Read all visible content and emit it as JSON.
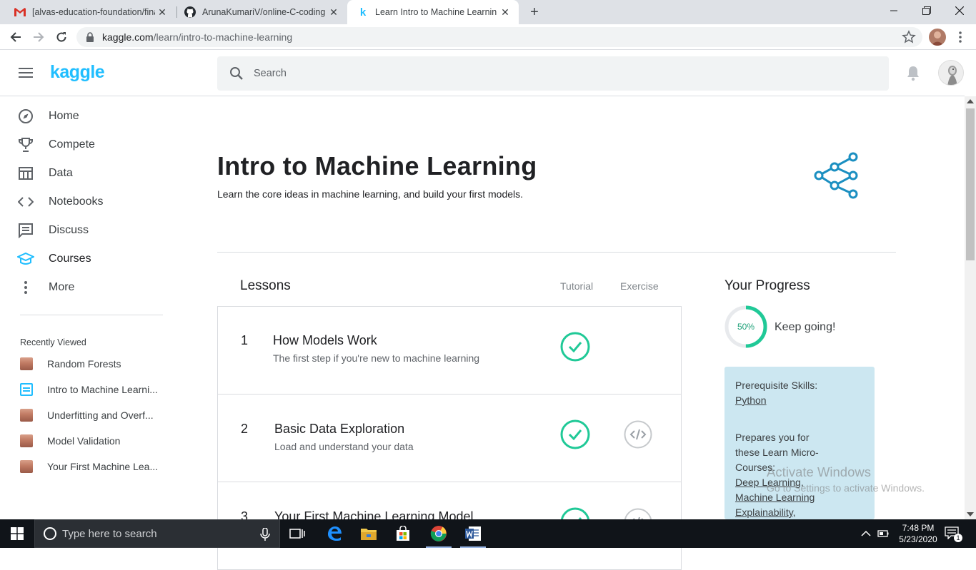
{
  "browser": {
    "tabs": [
      {
        "title": "[alvas-education-foundation/fina",
        "icon": "gmail-icon"
      },
      {
        "title": "ArunaKumariV/online-C-coding",
        "icon": "github-icon"
      },
      {
        "title": "Learn Intro to Machine Learning",
        "icon": "kaggle-icon"
      }
    ],
    "url_host": "kaggle.com",
    "url_path": "/learn/intro-to-machine-learning"
  },
  "header": {
    "logo": "kaggle",
    "search_placeholder": "Search"
  },
  "sidebar": {
    "items": [
      {
        "label": "Home",
        "icon": "compass-icon"
      },
      {
        "label": "Compete",
        "icon": "trophy-icon"
      },
      {
        "label": "Data",
        "icon": "table-icon"
      },
      {
        "label": "Notebooks",
        "icon": "code-icon"
      },
      {
        "label": "Discuss",
        "icon": "comment-icon"
      },
      {
        "label": "Courses",
        "icon": "graduation-cap-icon",
        "active": true
      },
      {
        "label": "More",
        "icon": "more-vertical-icon"
      }
    ],
    "recent_heading": "Recently Viewed",
    "recent": [
      "Random Forests",
      "Intro to Machine Learni...",
      "Underfitting and Overf...",
      "Model Validation",
      "Your First Machine Lea..."
    ]
  },
  "course": {
    "title": "Intro to Machine Learning",
    "subtitle": "Learn the core ideas in machine learning, and build your first models."
  },
  "lessons": {
    "heading": "Lessons",
    "col_tutorial": "Tutorial",
    "col_exercise": "Exercise",
    "items": [
      {
        "num": "1",
        "title": "How Models Work",
        "desc": "The first step if you're new to machine learning",
        "tutorial_done": true,
        "has_exercise": false
      },
      {
        "num": "2",
        "title": "Basic Data Exploration",
        "desc": "Load and understand your data",
        "tutorial_done": true,
        "has_exercise": true
      },
      {
        "num": "3",
        "title": "Your First Machine Learning Model",
        "desc": "",
        "tutorial_done": true,
        "has_exercise": true
      }
    ]
  },
  "progress": {
    "heading": "Your Progress",
    "percent": 50,
    "percent_label": "50%",
    "message": "Keep going!",
    "prereq_label": "Prerequisite Skills:",
    "prereq_link": "Python",
    "prepares_label": "Prepares you for these Learn Micro-Courses:",
    "prepares_links": [
      "Deep Learning,",
      "Machine Learning",
      "Explainability,"
    ]
  },
  "watermark": {
    "line1": "Activate Windows",
    "line2": "Go to Settings to activate Windows."
  },
  "taskbar": {
    "search_placeholder": "Type here to search",
    "time": "7:48 PM",
    "date": "5/23/2020",
    "notification_count": "1"
  },
  "colors": {
    "kaggle_blue": "#20beff",
    "check_green": "#20c997",
    "prereq_bg": "#cce7f1"
  }
}
